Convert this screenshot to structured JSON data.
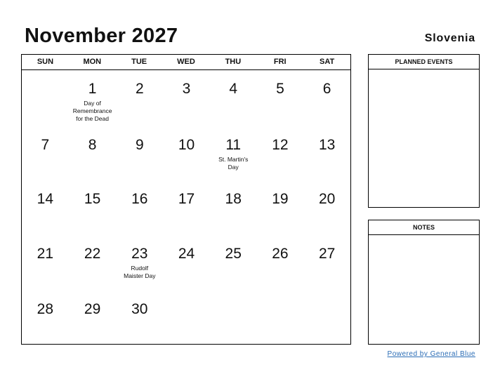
{
  "header": {
    "title": "November 2027",
    "country": "Slovenia"
  },
  "calendar": {
    "weekdays": [
      "SUN",
      "MON",
      "TUE",
      "WED",
      "THU",
      "FRI",
      "SAT"
    ],
    "weeks": [
      [
        {
          "day": ""
        },
        {
          "day": "1",
          "event": "Day of Remembrance for the Dead"
        },
        {
          "day": "2"
        },
        {
          "day": "3"
        },
        {
          "day": "4"
        },
        {
          "day": "5"
        },
        {
          "day": "6"
        }
      ],
      [
        {
          "day": "7"
        },
        {
          "day": "8"
        },
        {
          "day": "9"
        },
        {
          "day": "10"
        },
        {
          "day": "11",
          "event": "St. Martin's Day"
        },
        {
          "day": "12"
        },
        {
          "day": "13"
        }
      ],
      [
        {
          "day": "14"
        },
        {
          "day": "15"
        },
        {
          "day": "16"
        },
        {
          "day": "17"
        },
        {
          "day": "18"
        },
        {
          "day": "19"
        },
        {
          "day": "20"
        }
      ],
      [
        {
          "day": "21"
        },
        {
          "day": "22"
        },
        {
          "day": "23",
          "event": "Rudolf Maister Day"
        },
        {
          "day": "24"
        },
        {
          "day": "25"
        },
        {
          "day": "26"
        },
        {
          "day": "27"
        }
      ],
      [
        {
          "day": "28"
        },
        {
          "day": "29"
        },
        {
          "day": "30"
        },
        {
          "day": ""
        },
        {
          "day": ""
        },
        {
          "day": ""
        },
        {
          "day": ""
        }
      ]
    ]
  },
  "panels": {
    "planned_events": "PLANNED EVENTS",
    "notes": "NOTES"
  },
  "footer": {
    "powered_by": "Powered by General Blue",
    "link_color": "#2a6cb5"
  }
}
